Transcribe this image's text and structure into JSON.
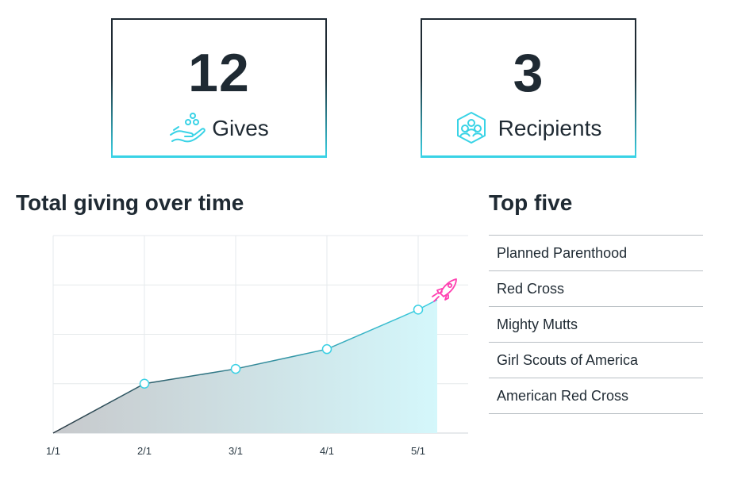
{
  "stats": {
    "gives": {
      "value": "12",
      "label": "Gives",
      "icon": "hand-giving-icon"
    },
    "recipients": {
      "value": "3",
      "label": "Recipients",
      "icon": "group-hexagon-icon"
    }
  },
  "chart": {
    "title": "Total giving over time",
    "marker_icon": "rocket-icon"
  },
  "chart_data": {
    "type": "area",
    "categories": [
      "1/1",
      "2/1",
      "3/1",
      "4/1",
      "5/1"
    ],
    "x": [
      "1/1",
      "2/1",
      "3/1",
      "4/1",
      "5/1",
      "end"
    ],
    "values": [
      0,
      1,
      1.3,
      1.7,
      2.5,
      2.7
    ],
    "ylim": [
      0,
      4
    ],
    "grid": true,
    "colors": {
      "line": "#3ad0e4",
      "fill_start": "#c7c9cc",
      "fill_end": "#d4f7fb",
      "dark_line": "#2b3a44",
      "rocket": "#ff3fb0"
    }
  },
  "top_five": {
    "title": "Top five",
    "items": [
      "Planned Parenthood",
      "Red Cross",
      "Mighty Mutts",
      "Girl Scouts of America",
      "American Red Cross"
    ]
  },
  "colors": {
    "accent": "#39d3e6",
    "text": "#1f2a33",
    "pink": "#ff3fb0"
  }
}
